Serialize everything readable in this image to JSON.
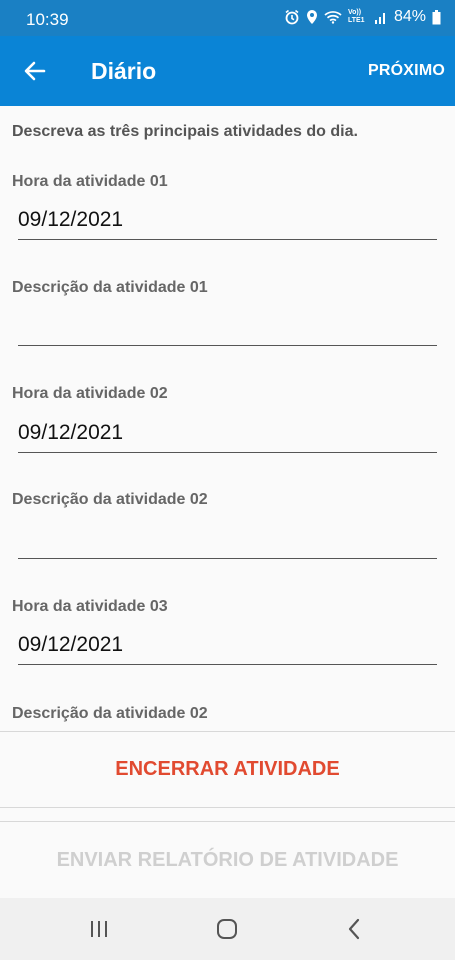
{
  "status_bar": {
    "time": "10:39",
    "battery": "84%",
    "network_label": "Vo)) LTE1",
    "icons": [
      "alarm-icon",
      "location-icon",
      "wifi-icon",
      "signal-icon",
      "battery-icon"
    ]
  },
  "app_bar": {
    "back_icon": "arrow-left-icon",
    "title": "Diário",
    "next_label": "PRÓXIMO"
  },
  "form": {
    "instructions": "Descreva as três principais atividades do dia.",
    "fields": [
      {
        "label": "Hora da atividade 01",
        "value": "09/12/2021"
      },
      {
        "label": "Descrição da atividade 01",
        "value": ""
      },
      {
        "label": "Hora da atividade 02",
        "value": "09/12/2021"
      },
      {
        "label": "Descrição da atividade 02",
        "value": ""
      },
      {
        "label": "Hora da atividade 03",
        "value": "09/12/2021"
      },
      {
        "label": "Descrição da atividade 02",
        "value": ""
      }
    ]
  },
  "actions": {
    "end_label": "ENCERRAR ATIVIDADE",
    "send_label": "ENVIAR RELATÓRIO DE ATIVIDADE"
  },
  "colors": {
    "status_bar": "#1a80c4",
    "app_bar": "#0a84d6",
    "end_button_text": "#e14a30",
    "send_button_text_disabled": "#cfcfcf"
  },
  "nav_bar": {
    "icons": [
      "recent-apps-icon",
      "home-icon",
      "back-icon"
    ]
  }
}
